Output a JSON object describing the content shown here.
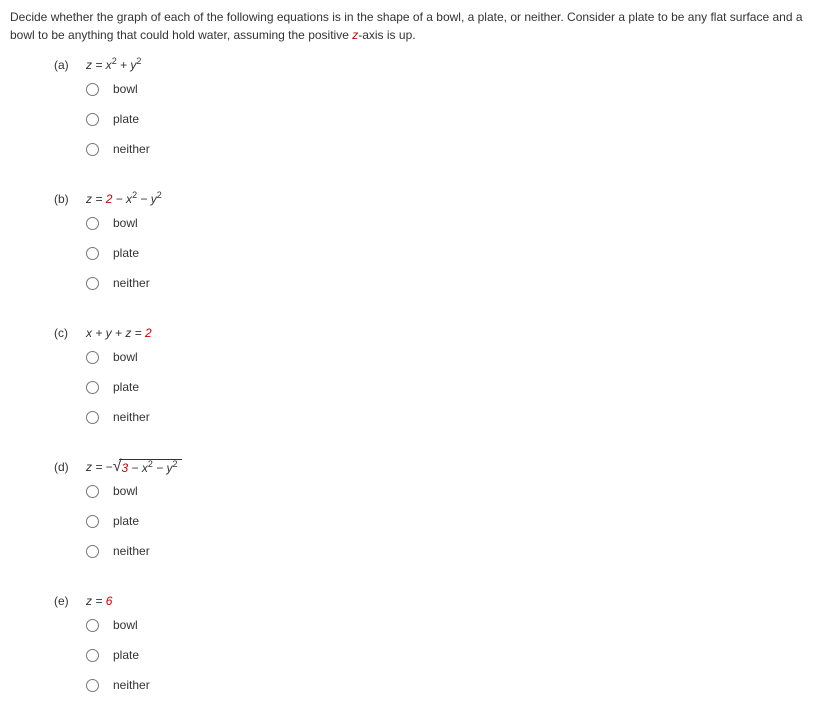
{
  "intro_p1": "Decide whether the graph of each of the following equations is in the shape of a bowl, a plate, or neither. Consider a plate to be any flat surface and a bowl to be anything that could hold water, assuming the positive ",
  "intro_z": "z",
  "intro_p2": "-axis is up.",
  "options": {
    "bowl": "bowl",
    "plate": "plate",
    "neither": "neither"
  },
  "problems": {
    "a": {
      "label": "(a)",
      "eq_prefix": "z = x",
      "eq_mid": " + y",
      "exp1": "2",
      "exp2": "2"
    },
    "b": {
      "label": "(b)",
      "eq_prefix": "z = ",
      "two": "2",
      "m1": " − x",
      "m2": " − y",
      "exp1": "2",
      "exp2": "2"
    },
    "c": {
      "label": "(c)",
      "eq": "x + y + z = ",
      "two": "2"
    },
    "d": {
      "label": "(d)",
      "eq_prefix": "z = −",
      "rad_prefix": "3",
      "m1": " − x",
      "m2": " − y",
      "exp1": "2",
      "exp2": "2"
    },
    "e": {
      "label": "(e)",
      "eq_prefix": "z = ",
      "six": "6"
    }
  }
}
